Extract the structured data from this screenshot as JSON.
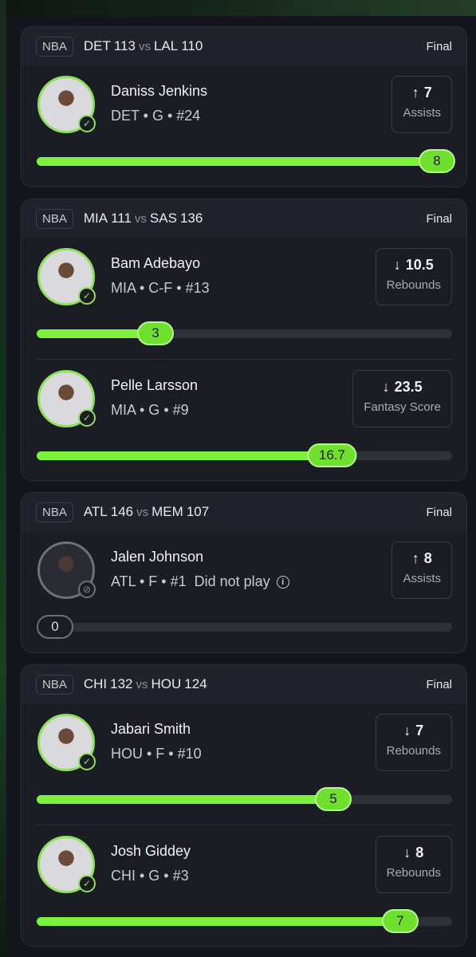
{
  "colors": {
    "accent": "#7cf23c",
    "card": "#1b1c24",
    "background": "#15161d"
  },
  "games": [
    {
      "league": "NBA",
      "away_team": "DET",
      "away_score": "113",
      "vs": "vs",
      "home_team": "LAL",
      "home_score": "110",
      "status": "Final",
      "players": [
        {
          "name": "Daniss Jenkins",
          "team": "DET",
          "position": "G",
          "number": "#24",
          "info": "DET • G • #24",
          "direction": "↑",
          "line": "7",
          "stat": "Assists",
          "actual": "8",
          "progress": 1.0,
          "played": true
        }
      ]
    },
    {
      "league": "NBA",
      "away_team": "MIA",
      "away_score": "111",
      "vs": "vs",
      "home_team": "SAS",
      "home_score": "136",
      "status": "Final",
      "players": [
        {
          "name": "Bam Adebayo",
          "info": "MIA • C-F • #13",
          "direction": "↓",
          "line": "10.5",
          "stat": "Rebounds",
          "actual": "3",
          "progress": 0.286,
          "played": true
        },
        {
          "name": "Pelle Larsson",
          "info": "MIA • G • #9",
          "direction": "↓",
          "line": "23.5",
          "stat": "Fantasy Score",
          "actual": "16.7",
          "progress": 0.711,
          "played": true
        }
      ]
    },
    {
      "league": "NBA",
      "away_team": "ATL",
      "away_score": "146",
      "vs": "vs",
      "home_team": "MEM",
      "home_score": "107",
      "status": "Final",
      "players": [
        {
          "name": "Jalen Johnson",
          "info": "ATL • F • #1",
          "dnp_label": "Did not play",
          "direction": "↑",
          "line": "8",
          "stat": "Assists",
          "actual": "0",
          "progress": 0,
          "played": false
        }
      ]
    },
    {
      "league": "NBA",
      "away_team": "CHI",
      "away_score": "132",
      "vs": "vs",
      "home_team": "HOU",
      "home_score": "124",
      "status": "Final",
      "players": [
        {
          "name": "Jabari Smith",
          "info": "HOU • F • #10",
          "direction": "↓",
          "line": "7",
          "stat": "Rebounds",
          "actual": "5",
          "progress": 0.714,
          "played": true
        },
        {
          "name": "Josh Giddey",
          "info": "CHI • G • #3",
          "direction": "↓",
          "line": "8",
          "stat": "Rebounds",
          "actual": "7",
          "progress": 0.875,
          "played": true
        }
      ]
    }
  ]
}
